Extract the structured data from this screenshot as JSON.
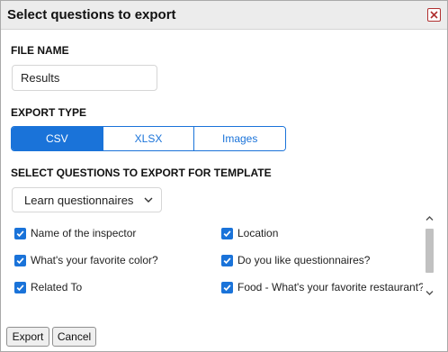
{
  "dialog": {
    "title": "Select questions to export"
  },
  "file_name": {
    "label": "FILE NAME",
    "value": "Results"
  },
  "export_type": {
    "label": "EXPORT TYPE",
    "options": [
      "CSV",
      "XLSX",
      "Images"
    ],
    "selected": "CSV"
  },
  "questions_section": {
    "label": "SELECT QUESTIONS TO EXPORT FOR TEMPLATE",
    "template_select": "Learn questionnaires",
    "items": [
      {
        "label": "Name of the inspector",
        "checked": true
      },
      {
        "label": "Location",
        "checked": true
      },
      {
        "label": "What's your favorite color?",
        "checked": true
      },
      {
        "label": "Do you like questionnaires?",
        "checked": true
      },
      {
        "label": "Related To",
        "checked": true
      },
      {
        "label": "Food - What's your favorite restaurant?",
        "checked": true
      }
    ]
  },
  "buttons": {
    "export": "Export",
    "cancel": "Cancel"
  },
  "colors": {
    "accent": "#1a73d9",
    "close": "#b03030"
  },
  "icons": {
    "close": "close-icon",
    "dropdown": "chevron-down-icon",
    "check": "check-icon"
  }
}
